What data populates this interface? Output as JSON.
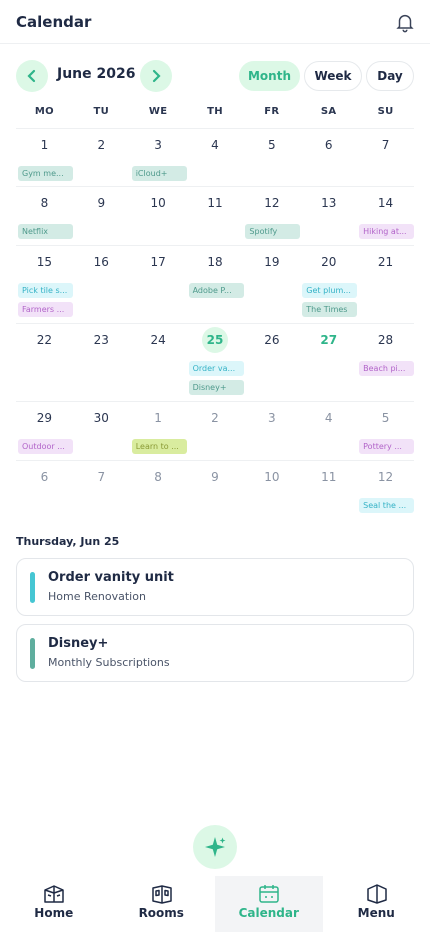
{
  "app": {
    "title": "Calendar"
  },
  "nav": {
    "month_label": "June 2026"
  },
  "views": {
    "month": "Month",
    "week": "Week",
    "day": "Day"
  },
  "days_of_week": [
    "MO",
    "TU",
    "WE",
    "TH",
    "FR",
    "SA",
    "SU"
  ],
  "weeks": [
    {
      "days": [
        {
          "num": "1",
          "events": [
            {
              "label": "Gym me...",
              "color": "green"
            }
          ]
        },
        {
          "num": "2",
          "events": []
        },
        {
          "num": "3",
          "events": [
            {
              "label": "iCloud+",
              "color": "green"
            }
          ]
        },
        {
          "num": "4",
          "events": []
        },
        {
          "num": "5",
          "events": []
        },
        {
          "num": "6",
          "events": []
        },
        {
          "num": "7",
          "events": []
        }
      ]
    },
    {
      "days": [
        {
          "num": "8",
          "events": [
            {
              "label": "Netflix",
              "color": "green"
            }
          ]
        },
        {
          "num": "9",
          "events": []
        },
        {
          "num": "10",
          "events": []
        },
        {
          "num": "11",
          "events": []
        },
        {
          "num": "12",
          "events": [
            {
              "label": "Spotify",
              "color": "green"
            }
          ]
        },
        {
          "num": "13",
          "events": []
        },
        {
          "num": "14",
          "events": [
            {
              "label": "Hiking at...",
              "color": "purple"
            }
          ]
        }
      ]
    },
    {
      "days": [
        {
          "num": "15",
          "events": [
            {
              "label": "Pick tile s...",
              "color": "cyan"
            },
            {
              "label": "Farmers ...",
              "color": "purple"
            }
          ]
        },
        {
          "num": "16",
          "events": []
        },
        {
          "num": "17",
          "events": []
        },
        {
          "num": "18",
          "events": [
            {
              "label": "Adobe P...",
              "color": "green"
            }
          ]
        },
        {
          "num": "19",
          "events": []
        },
        {
          "num": "20",
          "events": [
            {
              "label": "Get plum...",
              "color": "cyan"
            },
            {
              "label": "The Times",
              "color": "green"
            }
          ]
        },
        {
          "num": "21",
          "events": []
        }
      ]
    },
    {
      "days": [
        {
          "num": "22",
          "events": []
        },
        {
          "num": "23",
          "events": []
        },
        {
          "num": "24",
          "events": []
        },
        {
          "num": "25",
          "today": true,
          "events": [
            {
              "label": "Order va...",
              "color": "cyan"
            },
            {
              "label": "Disney+",
              "color": "green"
            }
          ]
        },
        {
          "num": "26",
          "events": []
        },
        {
          "num": "27",
          "sel": true,
          "events": []
        },
        {
          "num": "28",
          "events": [
            {
              "label": "Beach pi...",
              "color": "purple"
            }
          ]
        }
      ]
    },
    {
      "days": [
        {
          "num": "29",
          "events": [
            {
              "label": "Outdoor ...",
              "color": "purple"
            }
          ]
        },
        {
          "num": "30",
          "events": []
        },
        {
          "num": "1",
          "other": true,
          "events": [
            {
              "label": "Learn to ...",
              "color": "lime"
            }
          ]
        },
        {
          "num": "2",
          "other": true,
          "events": []
        },
        {
          "num": "3",
          "other": true,
          "events": []
        },
        {
          "num": "4",
          "other": true,
          "events": []
        },
        {
          "num": "5",
          "other": true,
          "events": [
            {
              "label": "Pottery ...",
              "color": "purple"
            }
          ]
        }
      ]
    },
    {
      "days": [
        {
          "num": "6",
          "other": true,
          "events": []
        },
        {
          "num": "7",
          "other": true,
          "events": []
        },
        {
          "num": "8",
          "other": true,
          "events": []
        },
        {
          "num": "9",
          "other": true,
          "events": []
        },
        {
          "num": "10",
          "other": true,
          "events": []
        },
        {
          "num": "11",
          "other": true,
          "events": []
        },
        {
          "num": "12",
          "other": true,
          "events": [
            {
              "label": "Seal the ...",
              "color": "cyan"
            }
          ]
        }
      ]
    }
  ],
  "selected_day": {
    "title": "Thursday, Jun 25",
    "events": [
      {
        "title": "Order vanity unit",
        "subtitle": "Home Renovation",
        "color": "#46c6d3"
      },
      {
        "title": "Disney+",
        "subtitle": "Monthly Subscriptions",
        "color": "#5fae9e"
      }
    ]
  },
  "bottom_nav": [
    {
      "label": "Home",
      "icon": "home-icon"
    },
    {
      "label": "Rooms",
      "icon": "rooms-icon"
    },
    {
      "label": "Calendar",
      "icon": "calendar-icon",
      "active": true
    },
    {
      "label": "Menu",
      "icon": "menu-icon"
    }
  ],
  "colors": {
    "accent": "#2fb58a",
    "accent_light": "#dcf8e6"
  }
}
